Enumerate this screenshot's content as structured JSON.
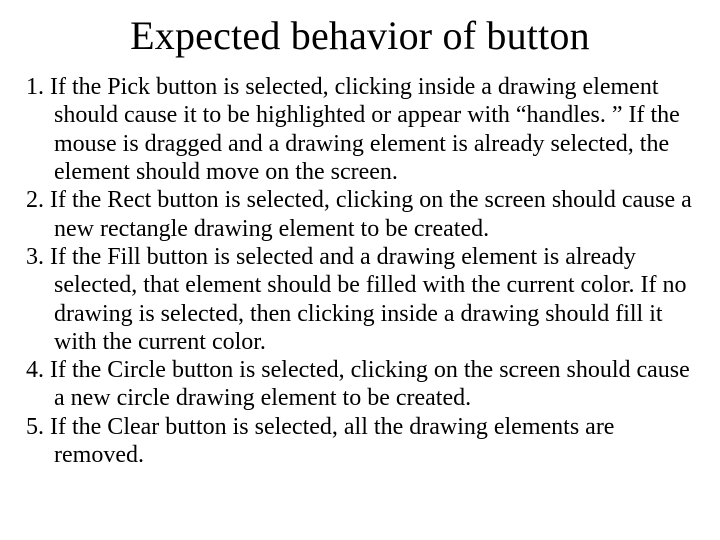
{
  "title": "Expected behavior of button",
  "items": [
    "If the Pick button is selected, clicking inside a drawing element should cause it to be highlighted or appear with “handles. ” If the mouse is dragged and a drawing element is already selected, the element should move on the screen.",
    "If the Rect button is selected, clicking on the screen should cause a new rectangle drawing element to be created.",
    "If the Fill button is selected and a drawing element is already selected, that element should be filled with the current color. If no drawing is selected, then clicking inside a drawing should fill it with the current color.",
    "If the Circle button is selected, clicking on the screen should cause a new circle drawing element to be created.",
    "If the Clear button is selected, all the drawing elements are removed."
  ]
}
